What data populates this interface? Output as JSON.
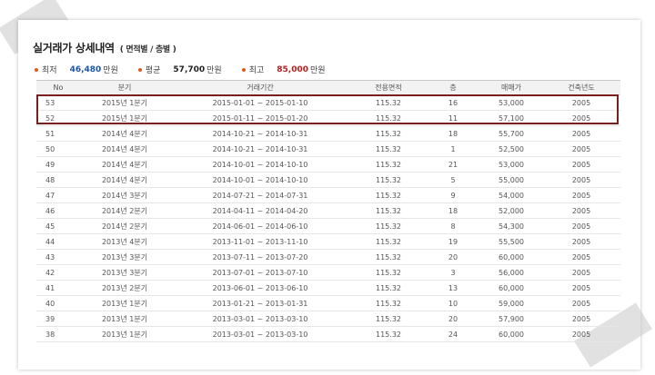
{
  "header": {
    "title": "실거래가 상세내역",
    "subtitle": "( 면적별 / 층별 )"
  },
  "stats": {
    "min_label": "최저",
    "min_value": "46,480",
    "avg_label": "평균",
    "avg_value": "57,700",
    "max_label": "최고",
    "max_value": "85,000",
    "unit": "만원"
  },
  "table": {
    "columns": [
      "No",
      "분기",
      "거래기간",
      "전용면적",
      "층",
      "매매가",
      "건축년도"
    ],
    "rows": [
      [
        "53",
        "2015년 1분기",
        "2015-01-01 ~ 2015-01-10",
        "115.32",
        "16",
        "53,000",
        "2005"
      ],
      [
        "52",
        "2015년 1분기",
        "2015-01-11 ~ 2015-01-20",
        "115.32",
        "11",
        "57,100",
        "2005"
      ],
      [
        "51",
        "2014년 4분기",
        "2014-10-21 ~ 2014-10-31",
        "115.32",
        "18",
        "55,700",
        "2005"
      ],
      [
        "50",
        "2014년 4분기",
        "2014-10-21 ~ 2014-10-31",
        "115.32",
        "1",
        "52,500",
        "2005"
      ],
      [
        "49",
        "2014년 4분기",
        "2014-10-01 ~ 2014-10-10",
        "115.32",
        "21",
        "53,000",
        "2005"
      ],
      [
        "48",
        "2014년 4분기",
        "2014-10-01 ~ 2014-10-10",
        "115.32",
        "5",
        "55,000",
        "2005"
      ],
      [
        "47",
        "2014년 3분기",
        "2014-07-21 ~ 2014-07-31",
        "115.32",
        "9",
        "54,000",
        "2005"
      ],
      [
        "46",
        "2014년 2분기",
        "2014-04-11 ~ 2014-04-20",
        "115.32",
        "18",
        "52,000",
        "2005"
      ],
      [
        "45",
        "2014년 2분기",
        "2014-06-01 ~ 2014-06-10",
        "115.32",
        "8",
        "54,300",
        "2005"
      ],
      [
        "44",
        "2013년 4분기",
        "2013-11-01 ~ 2013-11-10",
        "115.32",
        "19",
        "55,500",
        "2005"
      ],
      [
        "43",
        "2013년 3분기",
        "2013-07-11 ~ 2013-07-20",
        "115.32",
        "20",
        "60,000",
        "2005"
      ],
      [
        "42",
        "2013년 3분기",
        "2013-07-01 ~ 2013-07-10",
        "115.32",
        "3",
        "56,000",
        "2005"
      ],
      [
        "41",
        "2013년 2분기",
        "2013-06-01 ~ 2013-06-10",
        "115.32",
        "13",
        "60,000",
        "2005"
      ],
      [
        "40",
        "2013년 1분기",
        "2013-01-21 ~ 2013-01-31",
        "115.32",
        "10",
        "59,000",
        "2005"
      ],
      [
        "39",
        "2013년 1분기",
        "2013-03-01 ~ 2013-03-10",
        "115.32",
        "20",
        "57,900",
        "2005"
      ],
      [
        "38",
        "2013년 1분기",
        "2013-03-01 ~ 2013-03-10",
        "115.32",
        "24",
        "60,000",
        "2005"
      ]
    ]
  },
  "colors": {
    "min": "#1a56a8",
    "max": "#b81d1d",
    "bullet": "#e05a1e",
    "highlight_border": "#7a1f1f"
  }
}
